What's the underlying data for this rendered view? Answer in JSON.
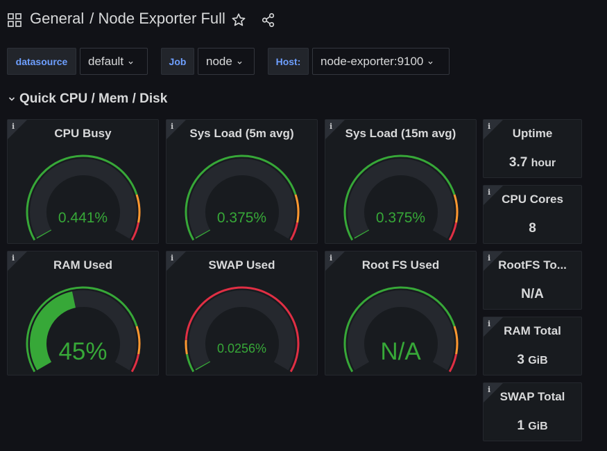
{
  "header": {
    "folder": "General",
    "dashboard": "/ Node Exporter Full"
  },
  "variables": [
    {
      "label": "datasource",
      "value": "default"
    },
    {
      "label": "Job",
      "value": "node"
    },
    {
      "label": "Host:",
      "value": "node-exporter:9100"
    }
  ],
  "row": {
    "title": "Quick CPU / Mem / Disk"
  },
  "gauges": [
    {
      "title": "CPU Busy",
      "value": "0.441%",
      "fraction": 0.00441
    },
    {
      "title": "Sys Load (5m avg)",
      "value": "0.375%",
      "fraction": 0.00375
    },
    {
      "title": "Sys Load (15m avg)",
      "value": "0.375%",
      "fraction": 0.00375
    },
    {
      "title": "RAM Used",
      "value": "45%",
      "fraction": 0.45
    },
    {
      "title": "SWAP Used",
      "value": "0.0256%",
      "fraction": 0.000256
    },
    {
      "title": "Root FS Used",
      "value": "N/A",
      "fraction": 0
    }
  ],
  "stats": [
    {
      "title": "Uptime",
      "value": "3.7",
      "unit": "hour"
    },
    {
      "title": "CPU Cores",
      "value": "8",
      "unit": ""
    },
    {
      "title": "RootFS To...",
      "value": "N/A",
      "unit": ""
    },
    {
      "title": "RAM Total",
      "value": "3",
      "unit": "GiB"
    },
    {
      "title": "SWAP Total",
      "value": "1",
      "unit": "GiB"
    }
  ],
  "colors": {
    "green": "#37a838",
    "orange": "#ff9830",
    "red": "#e02f44",
    "track": "#25282e"
  }
}
